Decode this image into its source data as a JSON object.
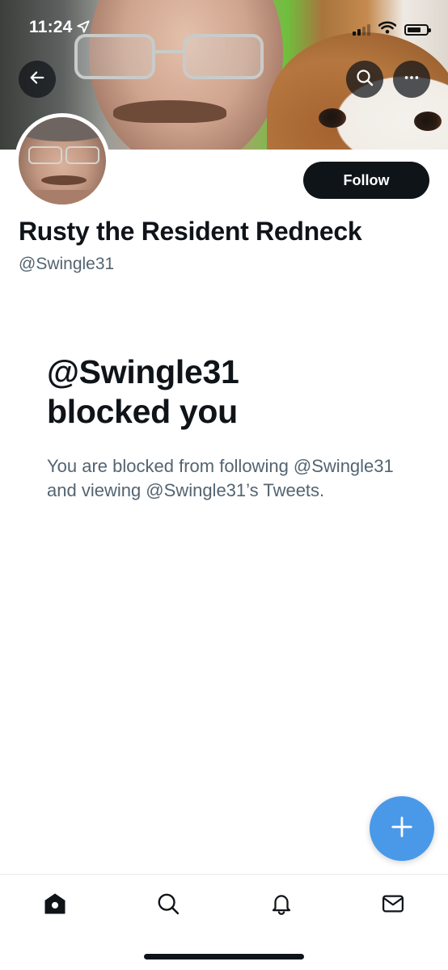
{
  "status_bar": {
    "time": "11:24"
  },
  "header": {
    "back_icon": "arrow-left-icon",
    "search_icon": "search-icon",
    "more_icon": "more-horizontal-icon"
  },
  "profile": {
    "display_name": "Rusty the Resident Redneck",
    "handle": "@Swingle31",
    "follow_label": "Follow"
  },
  "blocked": {
    "title_line1": "@Swingle31",
    "title_line2": "blocked you",
    "description": "You are blocked from following @Swingle31 and viewing @Swingle31’s Tweets."
  },
  "fab": {
    "icon": "plus-icon"
  },
  "bottom_nav": {
    "items": [
      {
        "icon": "home-icon",
        "active": true
      },
      {
        "icon": "search-icon",
        "active": false
      },
      {
        "icon": "bell-icon",
        "active": false
      },
      {
        "icon": "mail-icon",
        "active": false
      }
    ]
  },
  "colors": {
    "text_primary": "#0f1419",
    "text_secondary": "#536471",
    "fab": "#4a99e9",
    "follow_bg": "#0f1419"
  }
}
